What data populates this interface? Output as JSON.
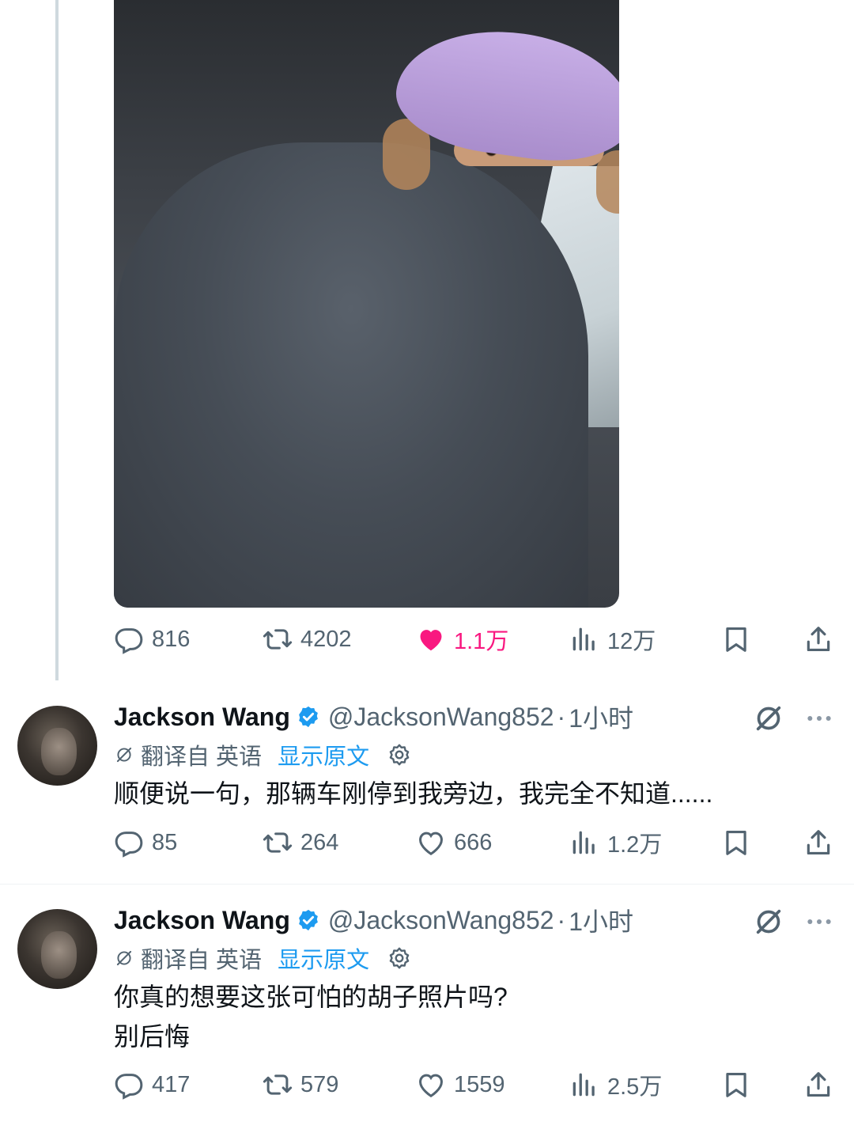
{
  "main_tweet": {
    "stats": {
      "replies": "816",
      "retweets": "4202",
      "likes": "1.1万",
      "views": "12万"
    }
  },
  "replies": [
    {
      "name": "Jackson Wang",
      "handle": "@JacksonWang852",
      "separator": "·",
      "time": "1小时",
      "translated_from": "翻译自 英语",
      "show_original": "显示原文",
      "text_lines": [
        "顺便说一句，那辆车刚停到我旁边，我完全不知道......"
      ],
      "stats": {
        "replies": "85",
        "retweets": "264",
        "likes": "666",
        "views": "1.2万"
      }
    },
    {
      "name": "Jackson Wang",
      "handle": "@JacksonWang852",
      "separator": "·",
      "time": "1小时",
      "translated_from": "翻译自 英语",
      "show_original": "显示原文",
      "text_lines": [
        "你真的想要这张可怕的胡子照片吗?",
        "别后悔"
      ],
      "stats": {
        "replies": "417",
        "retweets": "579",
        "likes": "1559",
        "views": "2.5万"
      }
    }
  ],
  "colors": {
    "accent": "#1d9bf0",
    "like": "#f91880",
    "muted": "#536471",
    "text": "#0f1419"
  },
  "icons": [
    "reply-icon",
    "retweet-icon",
    "like-icon",
    "views-icon",
    "bookmark-icon",
    "share-icon",
    "verified-icon",
    "grok-icon",
    "more-icon",
    "translate-icon",
    "settings-icon",
    "mute-icon"
  ]
}
